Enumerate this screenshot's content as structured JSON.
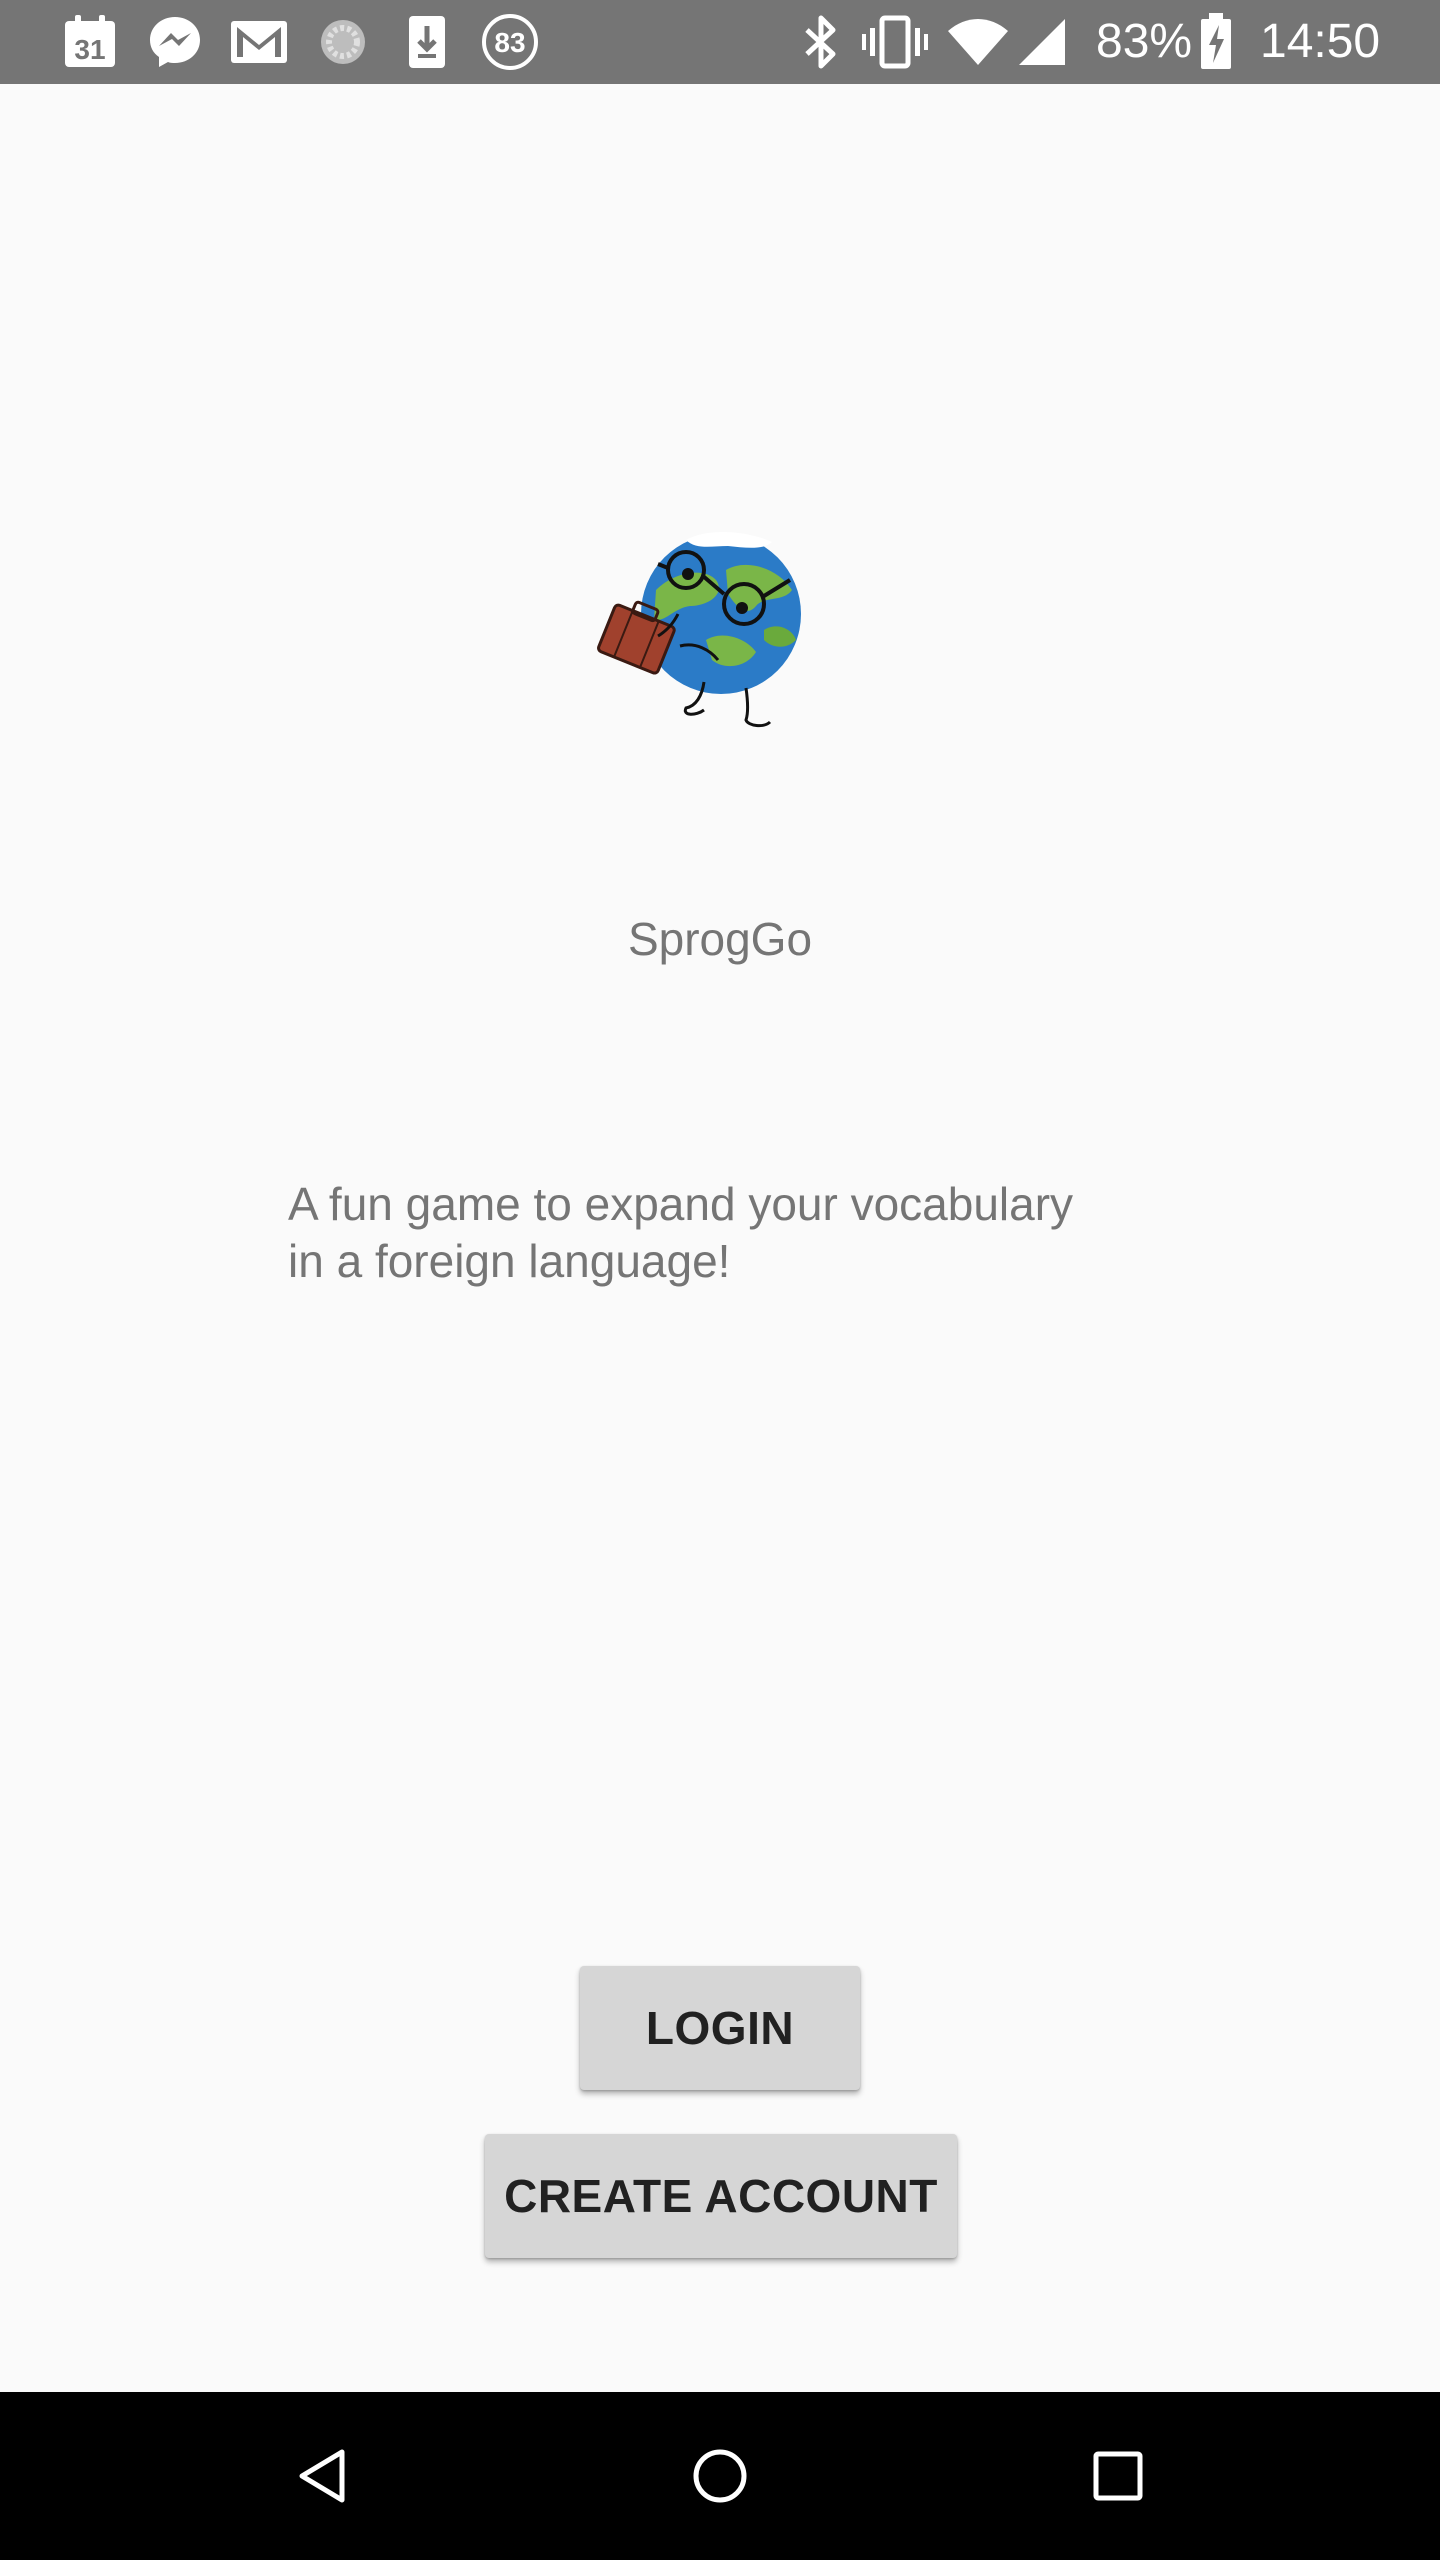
{
  "status_bar": {
    "calendar_day": "31",
    "notification_badge": "83",
    "battery_percent": "83%",
    "time": "14:50",
    "icons": [
      "calendar-icon",
      "messenger-icon",
      "gmail-icon",
      "sync-icon",
      "download-icon",
      "badge-83-icon",
      "bluetooth-icon",
      "vibrate-icon",
      "wifi-icon",
      "signal-icon",
      "battery-charging-icon"
    ]
  },
  "app": {
    "logo_icon": "globe-traveler-logo",
    "title": "SprogGo",
    "tagline_line1": "A fun game to expand your vocabulary",
    "tagline_line2": "in a foreign language!"
  },
  "actions": {
    "login_label": "LOGIN",
    "create_account_label": "CREATE ACCOUNT"
  },
  "nav_bar": {
    "icons": [
      "back-icon",
      "home-icon",
      "recents-icon"
    ]
  },
  "colors": {
    "status_bar": "#757575",
    "background": "#fafafa",
    "text_secondary": "#757575",
    "button": "#d6d6d6",
    "nav_bar": "#000000"
  }
}
